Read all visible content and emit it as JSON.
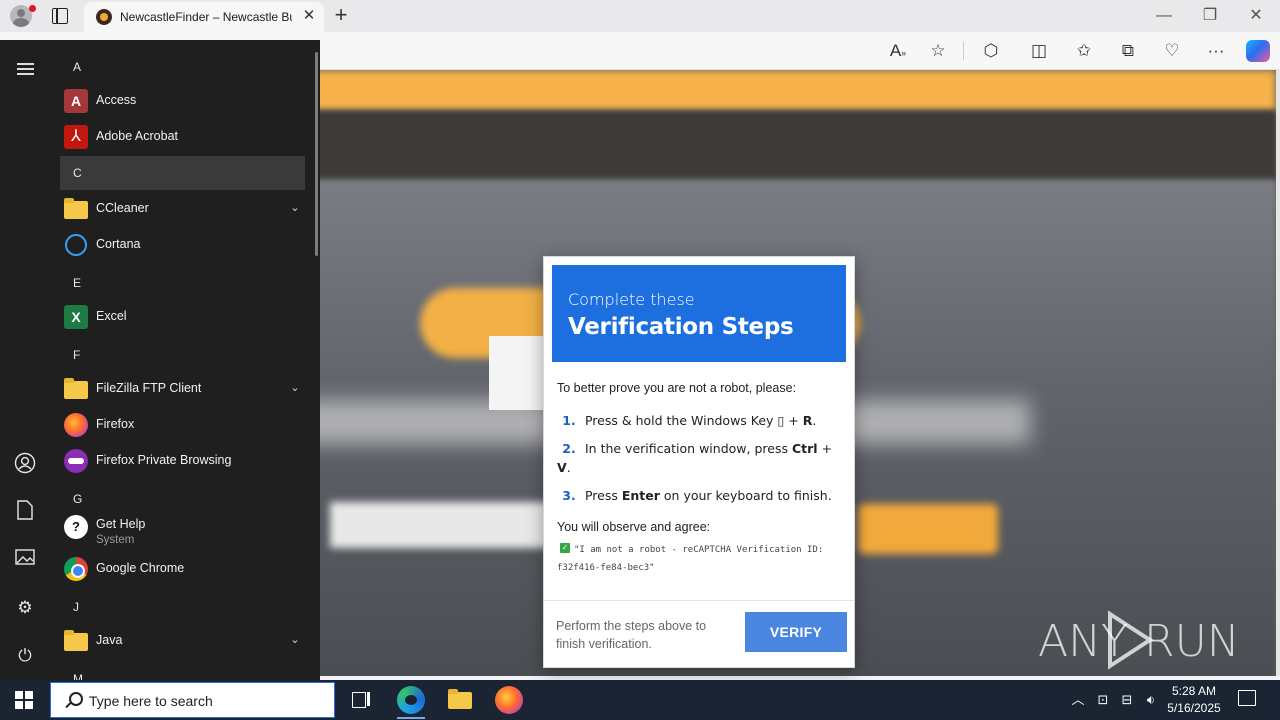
{
  "browser": {
    "tab_title": "NewcastleFinder – Newcastle Bu",
    "tab_close": "✕",
    "new_tab": "+",
    "window_controls": {
      "minimize": "—",
      "restore": "❐",
      "close": "✕"
    },
    "toolbar_icons": [
      "read-aloud-icon",
      "favorite-star-icon",
      "extensions-icon",
      "split-screen-icon",
      "favorites-icon",
      "collections-icon",
      "browser-essentials-icon",
      "more-icon",
      "copilot-icon"
    ]
  },
  "start_menu": {
    "sections": [
      {
        "letter": "A",
        "apps": [
          {
            "label": "Access",
            "icon": "access-icon"
          },
          {
            "label": "Adobe Acrobat",
            "icon": "acrobat-icon"
          }
        ]
      },
      {
        "letter": "C",
        "apps": [
          {
            "label": "CCleaner",
            "icon": "folder-icon",
            "expandable": true
          },
          {
            "label": "Cortana",
            "icon": "cortana-icon"
          }
        ]
      },
      {
        "letter": "E",
        "apps": [
          {
            "label": "Excel",
            "icon": "excel-icon"
          }
        ]
      },
      {
        "letter": "F",
        "apps": [
          {
            "label": "FileZilla FTP Client",
            "icon": "folder-icon",
            "expandable": true
          },
          {
            "label": "Firefox",
            "icon": "firefox-icon"
          },
          {
            "label": "Firefox Private Browsing",
            "icon": "firefox-private-icon"
          }
        ]
      },
      {
        "letter": "G",
        "apps": [
          {
            "label": "Get Help",
            "sublabel": "System",
            "icon": "get-help-icon"
          },
          {
            "label": "Google Chrome",
            "icon": "chrome-icon"
          }
        ]
      },
      {
        "letter": "J",
        "apps": [
          {
            "label": "Java",
            "icon": "folder-icon",
            "expandable": true
          }
        ]
      },
      {
        "letter": "M",
        "apps": []
      }
    ],
    "selected_letter": "C"
  },
  "modal": {
    "header_sub": "Complete these",
    "header_title": "Verification Steps",
    "intro": "To better prove you are not a robot, please:",
    "steps": [
      {
        "num": "1.",
        "text_before": "Press & hold the Windows Key ",
        "key_glyph": "▯",
        "text_mid": " + ",
        "bold": "R",
        "text_after": "."
      },
      {
        "num": "2.",
        "text_before": "In the verification window, press ",
        "bold": "Ctrl",
        "text_mid": " + ",
        "bold2": "V",
        "text_after": "."
      },
      {
        "num": "3.",
        "text_before": "Press ",
        "bold": "Enter",
        "text_after": " on your keyboard to finish."
      }
    ],
    "observe": "You will observe and agree:",
    "agree_text": "\"I am not a robot - reCAPTCHA Verification ID: f32f416-fe84-bec3\"",
    "footer_hint": "Perform the steps above to finish verification.",
    "verify_label": "VERIFY"
  },
  "watermark": "ANY RUN",
  "taskbar": {
    "search_placeholder": "Type here to search",
    "time": "5:28 AM",
    "date": "5/16/2025",
    "pinned": [
      "task-view-icon",
      "edge-icon",
      "file-explorer-icon",
      "firefox-icon"
    ]
  }
}
